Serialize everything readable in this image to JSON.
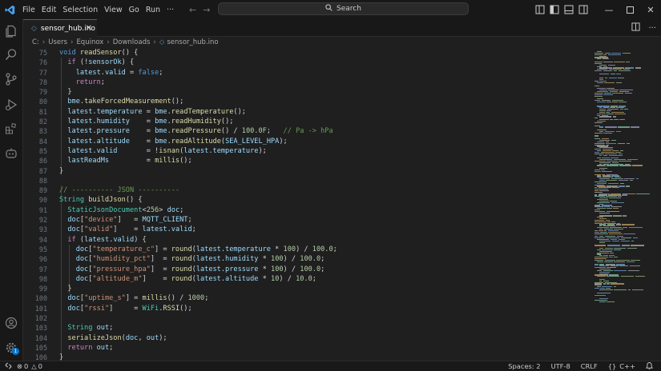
{
  "titlebar": {
    "menu": [
      "File",
      "Edit",
      "Selection",
      "View",
      "Go",
      "Run",
      "···"
    ],
    "search_label": "Search"
  },
  "tab": {
    "filename": "sensor_hub.ino"
  },
  "breadcrumb": [
    "C:",
    "Users",
    "Equinox",
    "Downloads",
    "sensor_hub.ino"
  ],
  "editor": {
    "line_numbers": [
      "75",
      "76",
      "77",
      "78",
      "79",
      "80",
      "81",
      "82",
      "83",
      "84",
      "85",
      "86",
      "87",
      "88",
      "89",
      "90",
      "91",
      "92",
      "93",
      "94",
      "95",
      "96",
      "97",
      "98",
      "99",
      "100",
      "101",
      "102",
      "103",
      "104",
      "105",
      "106"
    ]
  },
  "statusbar": {
    "errors": "0",
    "warnings": "0",
    "spaces": "Spaces: 2",
    "encoding": "UTF-8",
    "eol": "CRLF",
    "braces": "{}",
    "language": "C++",
    "badge": "1"
  },
  "colors": {
    "accent": "#0078d4",
    "background": "#1f1f1f",
    "chrome": "#181818"
  },
  "icons": [
    "vscode-logo-icon",
    "explorer-icon",
    "search-icon",
    "source-control-icon",
    "run-debug-icon",
    "extensions-icon",
    "copilot-icon",
    "account-icon",
    "settings-gear-icon",
    "remote-icon",
    "bell-icon"
  ]
}
